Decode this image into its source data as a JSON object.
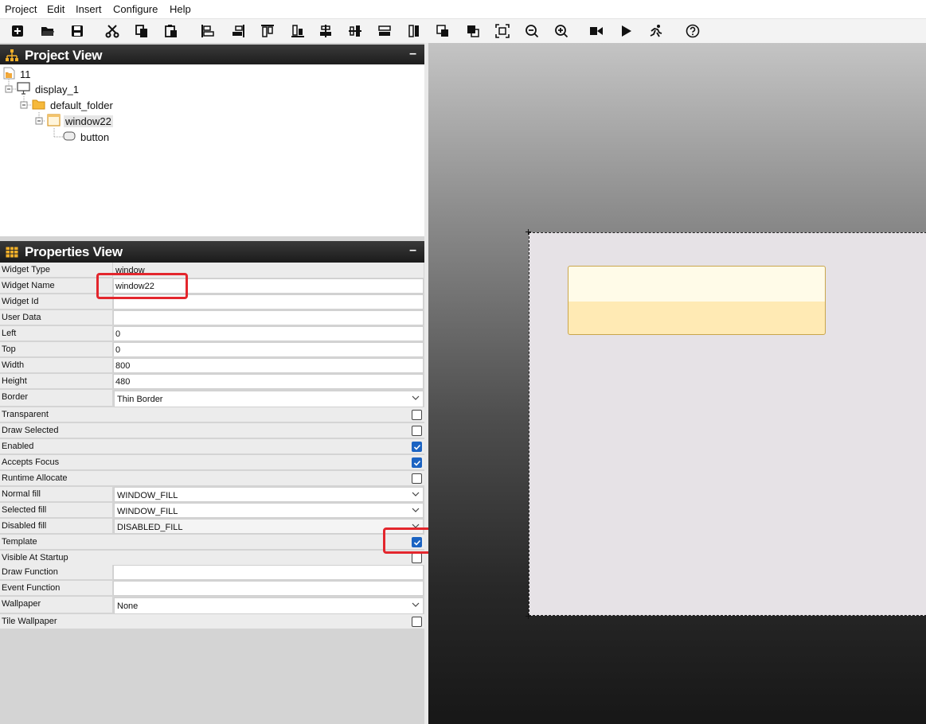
{
  "menu": [
    "Project",
    "Edit",
    "Insert",
    "Configure",
    "Help"
  ],
  "toolbar": {
    "icons": [
      "new-project-icon",
      "open-icon",
      "save-icon",
      "cut-icon",
      "copy-icon",
      "paste-icon",
      "align-left-icon",
      "align-right-icon",
      "align-top-icon",
      "align-bottom-icon",
      "center-vertical-icon",
      "center-horizontal-icon",
      "equal-height-icon",
      "equal-width-icon",
      "move-to-front-icon",
      "move-to-back-icon",
      "fit-to-window-icon",
      "zoom-out-icon",
      "zoom-in-icon",
      "run-to-end-icon",
      "play-icon",
      "run-app-icon",
      "help-icon"
    ]
  },
  "project_view": {
    "title": "Project View",
    "minimize": "–",
    "tree": {
      "project": "11",
      "display": "display_1",
      "folder": "default_folder",
      "window": "window22",
      "button": "button"
    }
  },
  "properties_view": {
    "title": "Properties View",
    "minimize": "–",
    "rows": {
      "widget_type": {
        "label": "Widget Type",
        "value": "window"
      },
      "widget_name": {
        "label": "Widget Name",
        "value": "window22"
      },
      "widget_id": {
        "label": "Widget Id",
        "value": ""
      },
      "user_data": {
        "label": "User Data",
        "value": ""
      },
      "left": {
        "label": "Left",
        "value": "0"
      },
      "top": {
        "label": "Top",
        "value": "0"
      },
      "width": {
        "label": "Width",
        "value": "800"
      },
      "height": {
        "label": "Height",
        "value": "480"
      },
      "border": {
        "label": "Border",
        "value": "Thin Border"
      },
      "transparent": {
        "label": "Transparent",
        "checked": false
      },
      "draw_selected": {
        "label": "Draw Selected",
        "checked": false
      },
      "enabled": {
        "label": "Enabled",
        "checked": true
      },
      "accepts_focus": {
        "label": "Accepts Focus",
        "checked": true
      },
      "runtime_allocate": {
        "label": "Runtime Allocate",
        "checked": false
      },
      "normal_fill": {
        "label": "Normal fill",
        "value": "WINDOW_FILL"
      },
      "selected_fill": {
        "label": "Selected fill",
        "value": "WINDOW_FILL"
      },
      "disabled_fill": {
        "label": "Disabled fill",
        "value": "DISABLED_FILL"
      },
      "template": {
        "label": "Template",
        "checked": true
      },
      "visible_at_startup": {
        "label": "Visible At Startup",
        "checked": false
      },
      "draw_function": {
        "label": "Draw Function",
        "value": ""
      },
      "event_function": {
        "label": "Event Function",
        "value": ""
      },
      "wallpaper": {
        "label": "Wallpaper",
        "value": "None"
      },
      "tile_wallpaper": {
        "label": "Tile Wallpaper",
        "checked": false
      }
    }
  },
  "colors": {
    "highlight": "#e3262d",
    "checkbox_checked": "#1b63c2",
    "panel_header": "#1b1b1b",
    "button_top": "#fffbe8",
    "button_bottom": "#ffeab4"
  }
}
